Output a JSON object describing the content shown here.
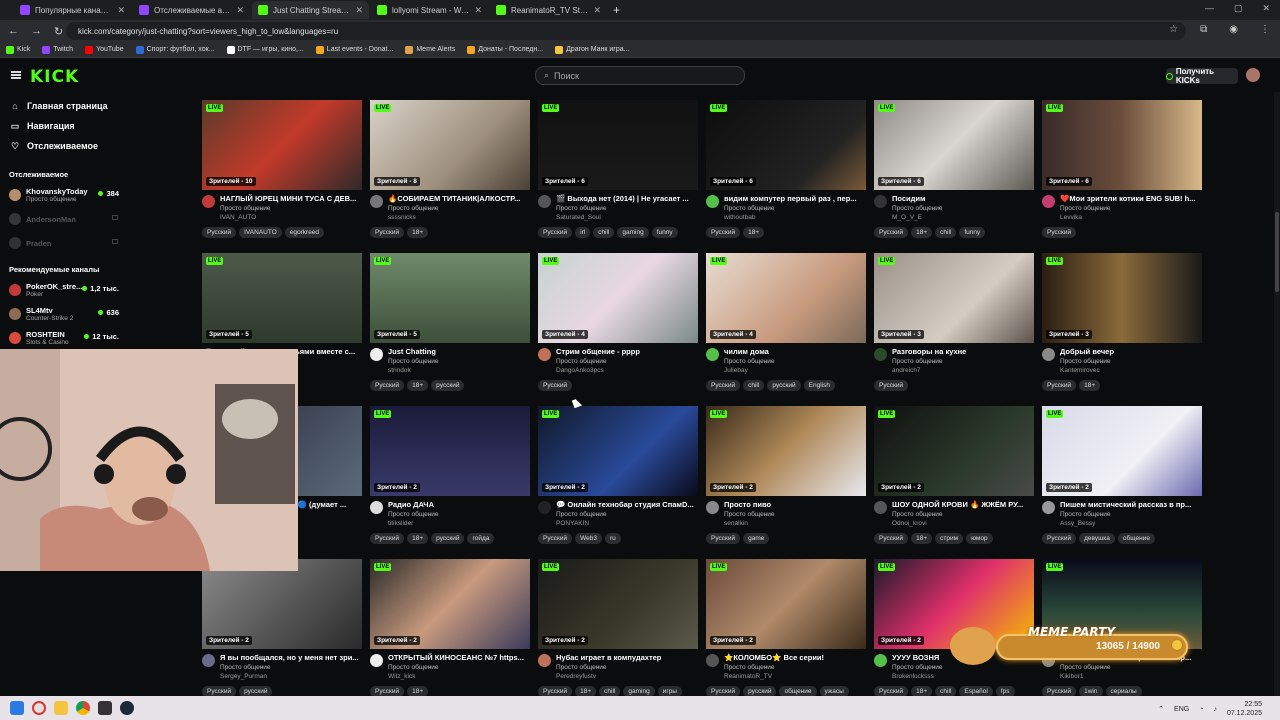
{
  "browser": {
    "tabs": [
      {
        "title": "Популярные каналы - Twitch",
        "color": "#9146ff",
        "active": false
      },
      {
        "title": "Отслеживаемые активные ка...",
        "color": "#9146ff",
        "active": false
      },
      {
        "title": "Just Chatting Streaming - Live ...",
        "color": "#53fc18",
        "active": true
      },
      {
        "title": "lollyomi Stream - Watch Live o...",
        "color": "#53fc18",
        "active": false
      },
      {
        "title": "ReanimatoR_TV Stream - Watch...",
        "color": "#53fc18",
        "active": false
      }
    ],
    "url": "kick.com/category/just-chatting?sort=viewers_high_to_low&languages=ru",
    "bookmarks": [
      {
        "label": "Kick",
        "color": "#53fc18"
      },
      {
        "label": "Twitch",
        "color": "#9146ff"
      },
      {
        "label": "YouTube",
        "color": "#ff0000"
      },
      {
        "label": "Спорт: футбол, хок...",
        "color": "#2a6ed6"
      },
      {
        "label": "DTF — игры, кино,...",
        "color": "#ffffff"
      },
      {
        "label": "Last events - Donat...",
        "color": "#f5a623"
      },
      {
        "label": "Meme Alerts",
        "color": "#e0a24d"
      },
      {
        "label": "Донаты - Последн...",
        "color": "#f5a623"
      },
      {
        "label": "Драгон Манк игра...",
        "color": "#f5c542"
      }
    ]
  },
  "header": {
    "logo": "KICK",
    "search_placeholder": "Поиск",
    "get_kicks": "Получить KICKs"
  },
  "sidebar": {
    "nav": [
      {
        "label": "Главная страница",
        "icon": "home-icon",
        "glyph": "⌂"
      },
      {
        "label": "Навигация",
        "icon": "compass-icon",
        "glyph": "▭"
      },
      {
        "label": "Отслеживаемое",
        "icon": "heart-icon",
        "glyph": "♡"
      }
    ],
    "following_title": "Отслеживаемое",
    "following": [
      {
        "name": "KhovanskyToday",
        "sub": "Просто общение",
        "viewers": "384",
        "online": true,
        "color": "#b58e6e"
      },
      {
        "name": "AndersonMan",
        "sub": "",
        "viewers": "",
        "online": false,
        "color": "#888888"
      },
      {
        "name": "Praden",
        "sub": "",
        "viewers": "",
        "online": false,
        "color": "#777777"
      }
    ],
    "recommended_title": "Рекомендуемые каналы",
    "recommended": [
      {
        "name": "PokerOK_stre...",
        "sub": "Poker",
        "viewers": "1,2 тыс.",
        "online": true,
        "color": "#c23a3a"
      },
      {
        "name": "SL4Mtv",
        "sub": "Counter-Strike 2",
        "viewers": "636",
        "online": true,
        "color": "#8d6b55"
      },
      {
        "name": "ROSHTEIN",
        "sub": "Slots & Casino",
        "viewers": "12 тыс.",
        "online": true,
        "color": "#d94b3a"
      }
    ]
  },
  "streams": [
    {
      "title": "НАГЛЫЙ ЮРЕЦ МИНИ ТУСА С ДЕВ...",
      "category": "Просто общение",
      "channel": "IVAN_AUTO",
      "viewers": "Зрителей - 10",
      "tags": [
        "Русский",
        "IVANAUTO",
        "egorkreed"
      ],
      "bg": "linear-gradient(135deg,#5a3b2b,#c33a2a 50%,#2e2a2a)",
      "av": "#c23a3a"
    },
    {
      "title": "🔥СОБИРАЕМ ТИТАНИК|АЛКОСТР...",
      "category": "Просто общение",
      "channel": "ssssnicks",
      "viewers": "Зрителей - 8",
      "tags": [
        "Русский",
        "18+"
      ],
      "bg": "linear-gradient(135deg,#d8d2c8,#9d8f7c 60%,#4a4036)",
      "av": "#777"
    },
    {
      "title": "🎬 Выхода нет (2014) | Не угасает ...",
      "category": "Просто общение",
      "channel": "Saturated_Soul",
      "viewers": "Зрителей - 6",
      "tags": [
        "Русский",
        "irl",
        "chill",
        "gaming",
        "funny"
      ],
      "bg": "linear-gradient(180deg,#111,#1a1a1a)",
      "av": "#555"
    },
    {
      "title": "видим компутер первый раз , пер...",
      "category": "Просто общение",
      "channel": "withoutbab",
      "viewers": "Зрителей - 6",
      "tags": [
        "Русский",
        "18+"
      ],
      "bg": "linear-gradient(135deg,#0d0d0d,#222 70%,#7a5a3a)",
      "av": "#53c04a"
    },
    {
      "title": "Посидим",
      "category": "Просто общение",
      "channel": "M_O_V_E",
      "viewers": "Зрителей - 6",
      "tags": [
        "Русский",
        "18+",
        "chill",
        "funny"
      ],
      "bg": "linear-gradient(135deg,#8e8a85,#d9d6d1 50%,#5d5953)",
      "av": "#333"
    },
    {
      "title": "❤️Мои зрители котики ENG SUB! h...",
      "category": "Просто общение",
      "channel": "Levvika",
      "viewers": "Зрителей - 6",
      "tags": [
        "Русский"
      ],
      "bg": "linear-gradient(90deg,#3a2a2a,#6b4e3c 50%,#d8b98a)",
      "av": "#c43d6b"
    },
    {
      "title": "Живой стрим с друзьями вместе с...",
      "category": "Просто общение",
      "channel": "",
      "viewers": "Зрителей - 5",
      "tags": [
        "Русский",
        "смотрю"
      ],
      "bg": "linear-gradient(180deg,#4d5a4a,#2e3a2c)",
      "av": "#555"
    },
    {
      "title": "Just Chatting",
      "category": "Просто общение",
      "channel": "strindok",
      "viewers": "Зрителей - 5",
      "tags": [
        "Русский",
        "18+",
        "русский"
      ],
      "bg": "linear-gradient(180deg,#6f8a6a,#3d4f3a)",
      "av": "#eee"
    },
    {
      "title": "Стрим общение - рррр",
      "category": "Просто общение",
      "channel": "DangoAnko3pcs",
      "viewers": "Зрителей - 4",
      "tags": [
        "Русский"
      ],
      "bg": "linear-gradient(135deg,#c7d3cf,#e8d7e3 50%,#7a8a86)",
      "av": "#c0715a"
    },
    {
      "title": "чилим дома",
      "category": "Просто общение",
      "channel": "Juliebay",
      "viewers": "Зрителей - 4",
      "tags": [
        "Русский",
        "chill",
        "русский",
        "English"
      ],
      "bg": "linear-gradient(135deg,#e8ddd2,#c89a7e 60%,#7a6a5a)",
      "av": "#53c04a"
    },
    {
      "title": "Разговоры на кухне",
      "category": "Просто общение",
      "channel": "andreich7",
      "viewers": "Зрителей - 3",
      "tags": [
        "Русский"
      ],
      "bg": "linear-gradient(135deg,#9a9088,#d5cdc3 60%,#5c544c)",
      "av": "#2a4a2a"
    },
    {
      "title": "Добрый вечер",
      "category": "Просто общение",
      "channel": "Kantemirovec",
      "viewers": "Зрителей - 3",
      "tags": [
        "Русский",
        "18+"
      ],
      "bg": "linear-gradient(90deg,#2a1e12,#8a6a3a 50%,#1a1a1a)",
      "av": "#888"
    },
    {
      "title": "Доброе утро с пулей🔵 (думает ...",
      "category": "Просто общение",
      "channel": "",
      "viewers": "Зрителей - 2",
      "tags": [
        "gaming",
        "razor"
      ],
      "bg": "linear-gradient(135deg,#2a2a3a,#5a6a7a)",
      "av": "#555"
    },
    {
      "title": "Радио ДАЧА",
      "category": "Просто общение",
      "channel": "titikslider",
      "viewers": "Зрителей - 2",
      "tags": [
        "Русский",
        "18+",
        "русский",
        "гойда"
      ],
      "bg": "linear-gradient(180deg,#1a1a3a,#3a3a6a)",
      "av": "#ddd"
    },
    {
      "title": "💬 Онлайн технобар студия СпамD...",
      "category": "Просто общение",
      "channel": "PONYAKIN",
      "viewers": "Зрителей - 2",
      "tags": [
        "Русский",
        "Web3",
        "ru"
      ],
      "bg": "linear-gradient(135deg,#101828,#2a4a9a 60%,#0a0a1a)",
      "av": "#222"
    },
    {
      "title": "Просто пиво",
      "category": "Просто общение",
      "channel": "senalkin",
      "viewers": "Зрителей - 2",
      "tags": [
        "Русский",
        "game"
      ],
      "bg": "linear-gradient(135deg,#3a2a1a,#b08a5a 50%,#e8e8f0)",
      "av": "#888"
    },
    {
      "title": "ШОУ ОДНОЙ КРОВИ 🔥 ЖЖЁМ РУ...",
      "category": "Просто общение",
      "channel": "Odnoi_krovi",
      "viewers": "Зрителей - 2",
      "tags": [
        "Русский",
        "18+",
        "стрим",
        "юмор"
      ],
      "bg": "linear-gradient(135deg,#101010,#2a3a2a 60%,#4a4a4a)",
      "av": "#555"
    },
    {
      "title": "Пишем мистический рассказ в пр...",
      "category": "Просто общение",
      "channel": "Assy_Bessy",
      "viewers": "Зрителей - 2",
      "tags": [
        "Русский",
        "девушка",
        "общение"
      ],
      "bg": "linear-gradient(135deg,#d8dae8,#f0f0f5 60%,#6a6ab0)",
      "av": "#999"
    },
    {
      "title": "Я вы пообщался, но у меня нет зри...",
      "category": "Просто общение",
      "channel": "Sergey_Purman",
      "viewers": "Зрителей - 2",
      "tags": [
        "Русский",
        "русский"
      ],
      "bg": "linear-gradient(135deg,#8a8a8a,#2a2a2a)",
      "av": "#6a6a8a"
    },
    {
      "title": "ОТКРЫТЫЙ КИНОСЕАНС №7 https...",
      "category": "Просто общение",
      "channel": "Witz_kick",
      "viewers": "Зрителей - 2",
      "tags": [
        "Русский",
        "18+"
      ],
      "bg": "linear-gradient(135deg,#2a2a2a,#c89a7e 50%,#3a3a5a)",
      "av": "#eee"
    },
    {
      "title": "Нубас играет в компудахтер",
      "category": "Просто общение",
      "channel": "Peredreyfustv",
      "viewers": "Зрителей - 2",
      "tags": [
        "Русский",
        "18+",
        "chill",
        "gaming",
        "игры"
      ],
      "bg": "linear-gradient(135deg,#1a1a1a,#3a3a2a 60%,#5a5a4a)",
      "av": "#c0715a"
    },
    {
      "title": "⭐КОЛОМБО⭐ Все серии!",
      "category": "Просто общение",
      "channel": "ReanimatoR_TV",
      "viewers": "Зрителей - 2",
      "tags": [
        "Русский",
        "русский",
        "общение",
        "ужасы"
      ],
      "bg": "linear-gradient(135deg,#6a4a3a,#b08a6a 50%,#3a2a1a)",
      "av": "#555"
    },
    {
      "title": "УУУУ ВОЗНЯ",
      "category": "Просто общение",
      "channel": "Brokenlocksss",
      "viewers": "Зрителей - 2",
      "tags": [
        "Русский",
        "18+",
        "chill",
        "Español",
        "fps"
      ],
      "bg": "linear-gradient(135deg,#1a1a2a,#e0306a 50%,#f5c000)",
      "av": "#53c04a"
    },
    {
      "title": "Пишем мистический рассказ в пр...",
      "category": "Просто общение",
      "channel": "Kikibor1",
      "viewers": "Зрителей - 2",
      "tags": [
        "Русский",
        "1win",
        "сериалы"
      ],
      "bg": "linear-gradient(180deg,#0a0a1a,#2a4a3a 60%,#6a5a3a)",
      "av": "#888"
    }
  ],
  "meme_party": {
    "title": "MEME PARTY",
    "count": "13065 / 14900"
  },
  "taskbar": {
    "lang": "ENG",
    "time": "22:55",
    "date": "07.12.2025"
  }
}
